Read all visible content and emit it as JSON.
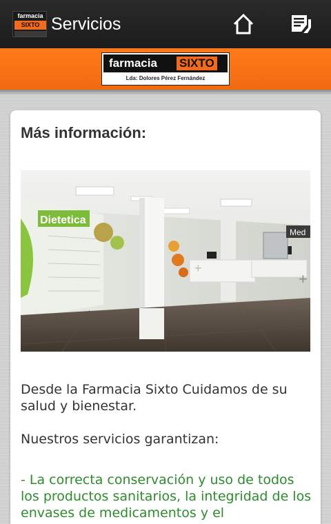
{
  "actionbar": {
    "logo_line1": "farmacia",
    "logo_line2": "SIXTO",
    "title": "Servicios",
    "home_icon": "home-icon",
    "menu_icon": "list-menu-icon"
  },
  "banner": {
    "brand_word1": "farmacia",
    "brand_word2": "SIXTO",
    "brand_subtitle": "Lda: Dolores Pérez Fernández"
  },
  "content": {
    "heading": "Más información:",
    "photo_signs": {
      "left": "Dietetica",
      "right": "Med"
    },
    "paragraph1": "Desde la Farmacia Sixto Cuidamos de su salud y bienestar.",
    "paragraph2": "Nuestros servicios garantizan:",
    "paragraph3": "- La correcta conservación y uso de todos los productos sanitarios, la integridad de los envases de medicamentos y el"
  },
  "colors": {
    "brand_orange": "#f26a1b",
    "actionbar_bg": "#1f1f1f",
    "highlight_green": "#2e8b2e"
  }
}
